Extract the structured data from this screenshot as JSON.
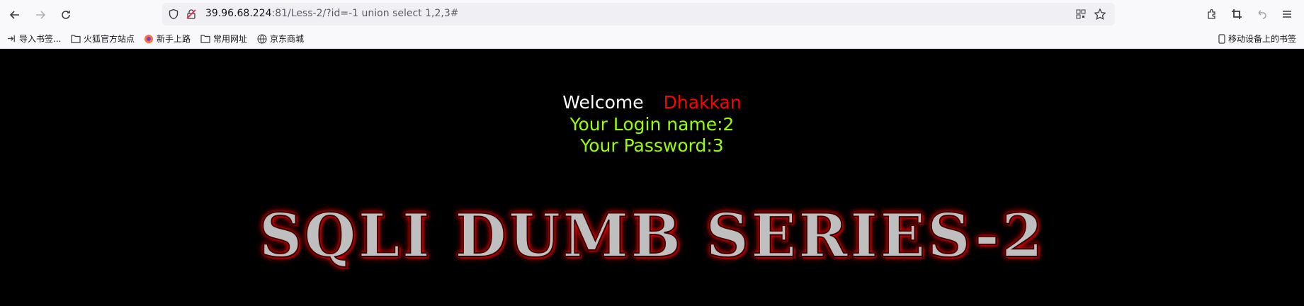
{
  "browser": {
    "url_host": "39.96.68.224",
    "url_rest": ":81/Less-2/?id=-1 union select 1,2,3#",
    "bookmarks": [
      "导入书签...",
      "火狐官方站点",
      "新手上路",
      "常用网址",
      "京东商城"
    ],
    "mobile_bookmarks": "移动设备上的书签"
  },
  "page": {
    "welcome": "Welcome",
    "user": "Dhakkan",
    "login_name": "Your Login name:2",
    "password": "Your Password:3",
    "banner": "SQLI DUMB SERIES-2"
  },
  "colors": {
    "welcome": "#ffffff",
    "user": "#ff0000",
    "info": "#99ff00",
    "background": "#000000"
  }
}
